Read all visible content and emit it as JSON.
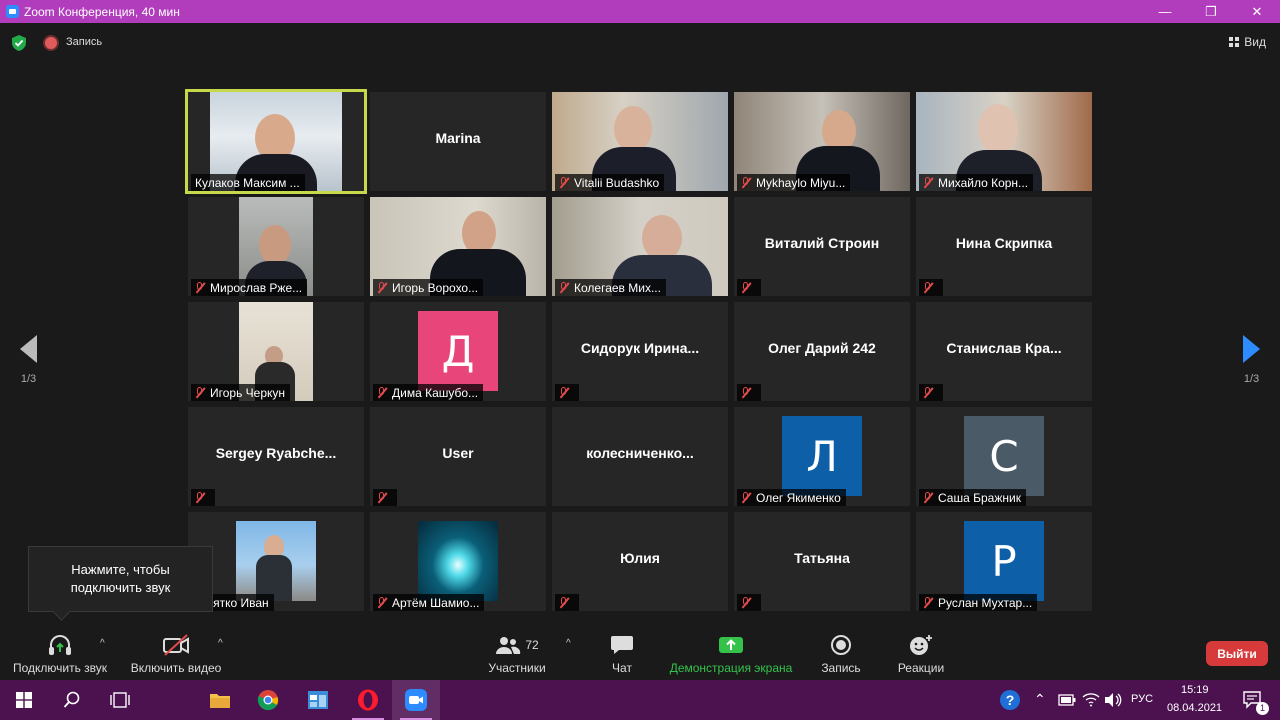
{
  "window": {
    "title": "Zoom Конференция, 40 мин",
    "controls": [
      "—",
      "❐",
      "✕"
    ]
  },
  "topbar": {
    "record_label": "Запись",
    "view_label": "Вид"
  },
  "pager": {
    "left_label": "1/3",
    "right_label": "1/3"
  },
  "tooltip": {
    "line1": "Нажмите, чтобы",
    "line2": "подключить звук"
  },
  "tiles": [
    {
      "name": "Кулаков Максим ..."
    },
    {
      "name": "Marina"
    },
    {
      "name": "Vitalii Budashko"
    },
    {
      "name": "Mykhaylo Miyu..."
    },
    {
      "name": "Михайло Корн..."
    },
    {
      "name": "Мирослав Рже..."
    },
    {
      "name": "Игорь Ворохо..."
    },
    {
      "name": "Колегаев Мих..."
    },
    {
      "name": "Виталий Строин"
    },
    {
      "name": "Нина Скрипка"
    },
    {
      "name": "Игорь Черкун"
    },
    {
      "name": "Дима Кашубо...",
      "avatar": "Д",
      "avatar_color": "#e8457a"
    },
    {
      "name": "Сидорук  Ирина..."
    },
    {
      "name": "Олег Дарий 242"
    },
    {
      "name": "Станислав  Кра..."
    },
    {
      "name": "Sergey  Ryabche..."
    },
    {
      "name": "User"
    },
    {
      "name": "колесниченко..."
    },
    {
      "name": "Олег Якименко",
      "avatar": "Л",
      "avatar_color": "#0d5fa8"
    },
    {
      "name": "Саша Бражник",
      "avatar": "С",
      "avatar_color": "#4a5a66"
    },
    {
      "name": "Гурятко Иван"
    },
    {
      "name": "Артём Шамио..."
    },
    {
      "name": "Юлия"
    },
    {
      "name": "Татьяна"
    },
    {
      "name": "Руслан Мухтар...",
      "avatar": "Р",
      "avatar_color": "#0d5fa8"
    }
  ],
  "toolbar": {
    "audio": "Подключить звук",
    "video": "Включить видео",
    "participants": "Участники",
    "participants_count": "72",
    "chat": "Чат",
    "share": "Демонстрация экрана",
    "record": "Запись",
    "reactions": "Реакции",
    "leave": "Выйти"
  },
  "taskbar": {
    "lang": "РУС",
    "time": "15:19",
    "date": "08.04.2021",
    "notif_count": "1"
  },
  "colors": {
    "titlebar": "#b13dbd",
    "taskbar": "#4b124f",
    "active_speaker": "#c7d94a",
    "leave": "#d63a3a",
    "share": "#34c24b"
  }
}
